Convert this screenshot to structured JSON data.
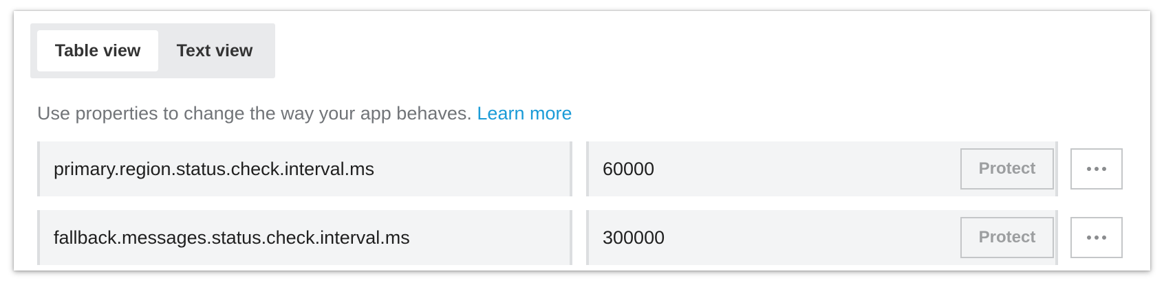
{
  "view_toggle": {
    "table_view_label": "Table view",
    "text_view_label": "Text view",
    "selected": "Table view"
  },
  "description": {
    "text": "Use properties to change the way your app behaves.",
    "link_label": "Learn more"
  },
  "properties": [
    {
      "key": "primary.region.status.check.interval.ms",
      "value": "60000",
      "protect_label": "Protect",
      "more_icon": "ellipsis-icon"
    },
    {
      "key": "fallback.messages.status.check.interval.ms",
      "value": "300000",
      "protect_label": "Protect",
      "more_icon": "ellipsis-icon"
    }
  ],
  "colors": {
    "link": "#1a9bd7",
    "field_background": "#f3f4f5",
    "toggle_background": "#e9eaec",
    "muted_text": "#717478"
  }
}
